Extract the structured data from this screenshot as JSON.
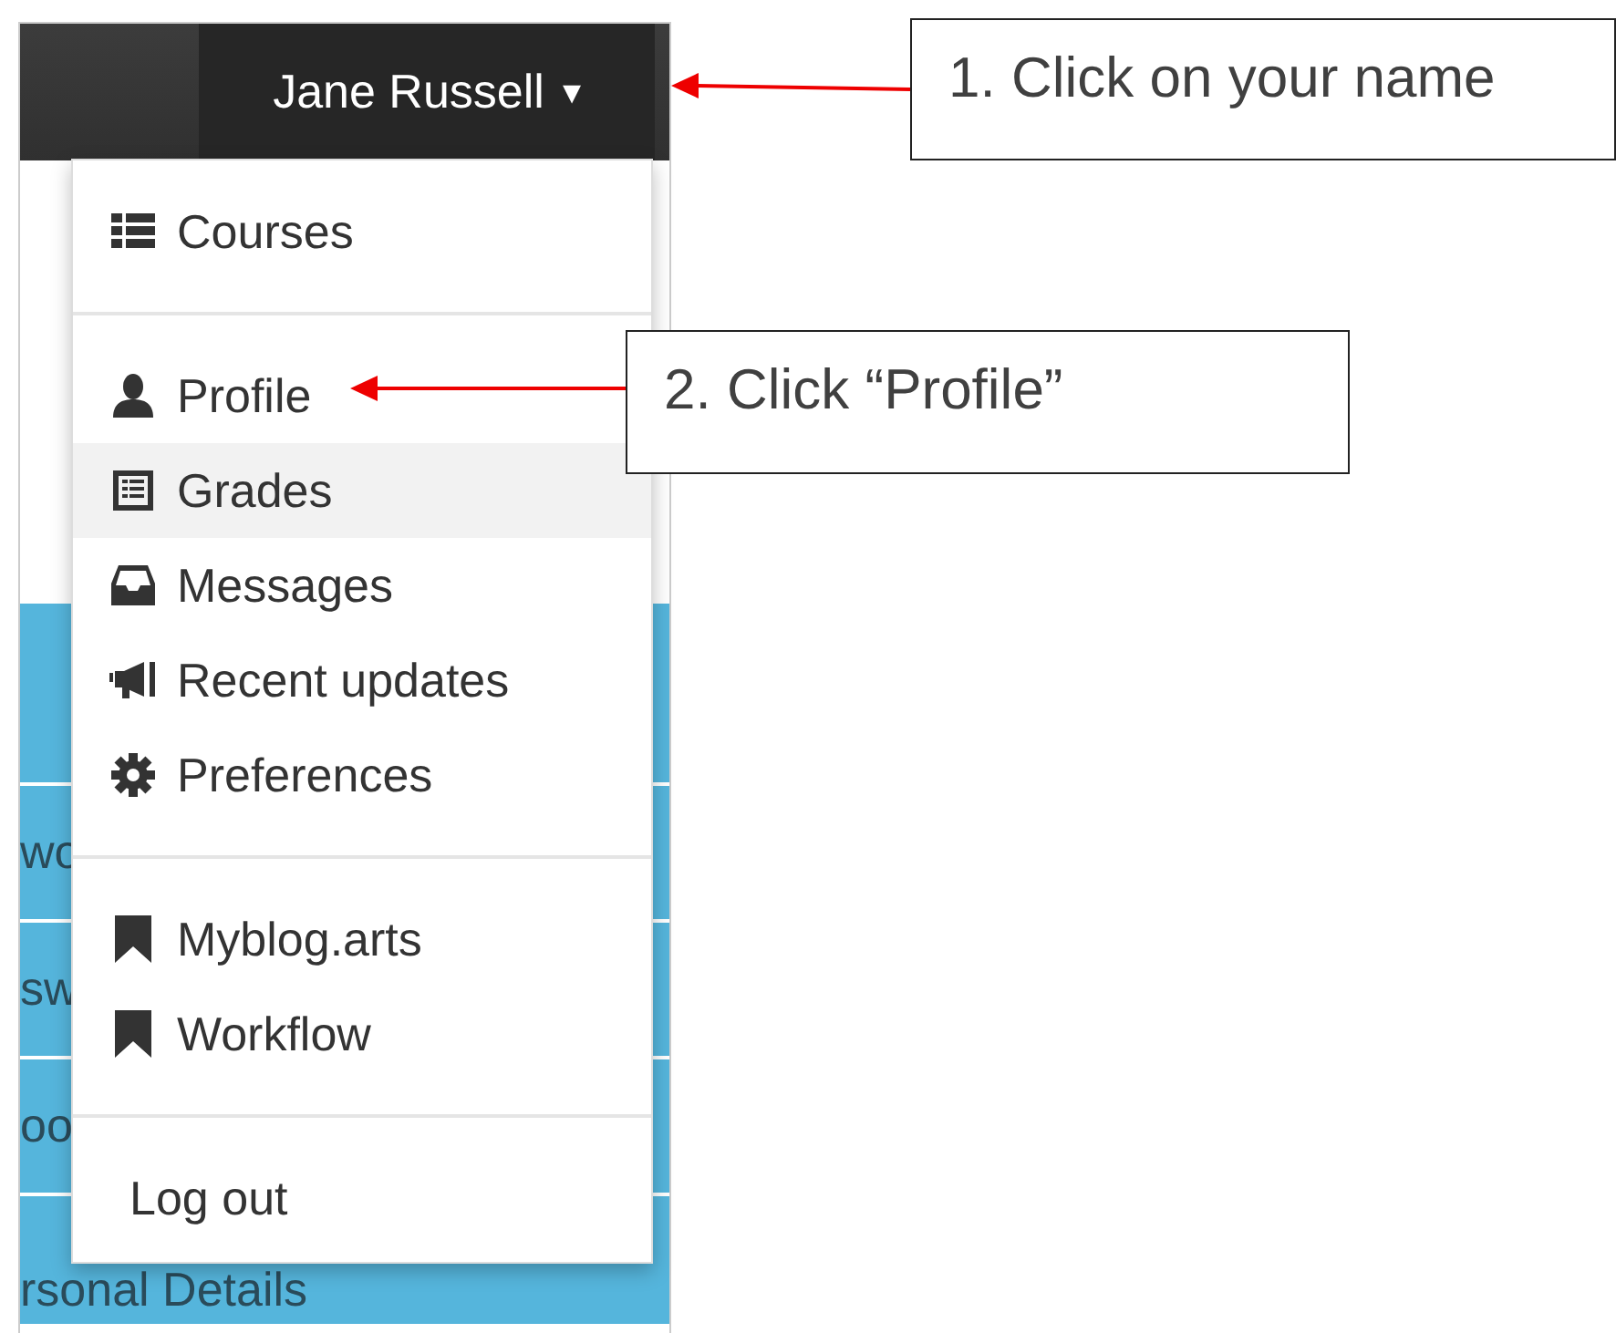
{
  "navbar": {
    "user_name": "Jane Russell",
    "caret": "▾"
  },
  "background_rows": [
    {
      "text": ""
    },
    {
      "text": "wo"
    },
    {
      "text": "sw"
    },
    {
      "text": "oo"
    },
    {
      "text": "rsonal Details"
    }
  ],
  "user_menu": {
    "groups": [
      {
        "items": [
          {
            "label": "Courses",
            "kind": "list",
            "highlighted": false
          }
        ]
      },
      {
        "items": [
          {
            "label": "Profile",
            "kind": "user",
            "highlighted": false
          },
          {
            "label": "Grades",
            "kind": "table",
            "highlighted": true
          },
          {
            "label": "Messages",
            "kind": "inbox",
            "highlighted": false
          },
          {
            "label": "Recent updates",
            "kind": "megaphone",
            "highlighted": false
          },
          {
            "label": "Preferences",
            "kind": "gear",
            "highlighted": false
          }
        ]
      },
      {
        "items": [
          {
            "label": "Myblog.arts",
            "kind": "bookmark",
            "highlighted": false
          },
          {
            "label": "Workflow",
            "kind": "bookmark",
            "highlighted": false
          }
        ]
      },
      {
        "items": [
          {
            "label": "Log out",
            "kind": "plain",
            "highlighted": false
          }
        ]
      }
    ]
  },
  "callouts": [
    {
      "text": "1. Click on your name"
    },
    {
      "text": "2. Click “Profile”"
    }
  ]
}
